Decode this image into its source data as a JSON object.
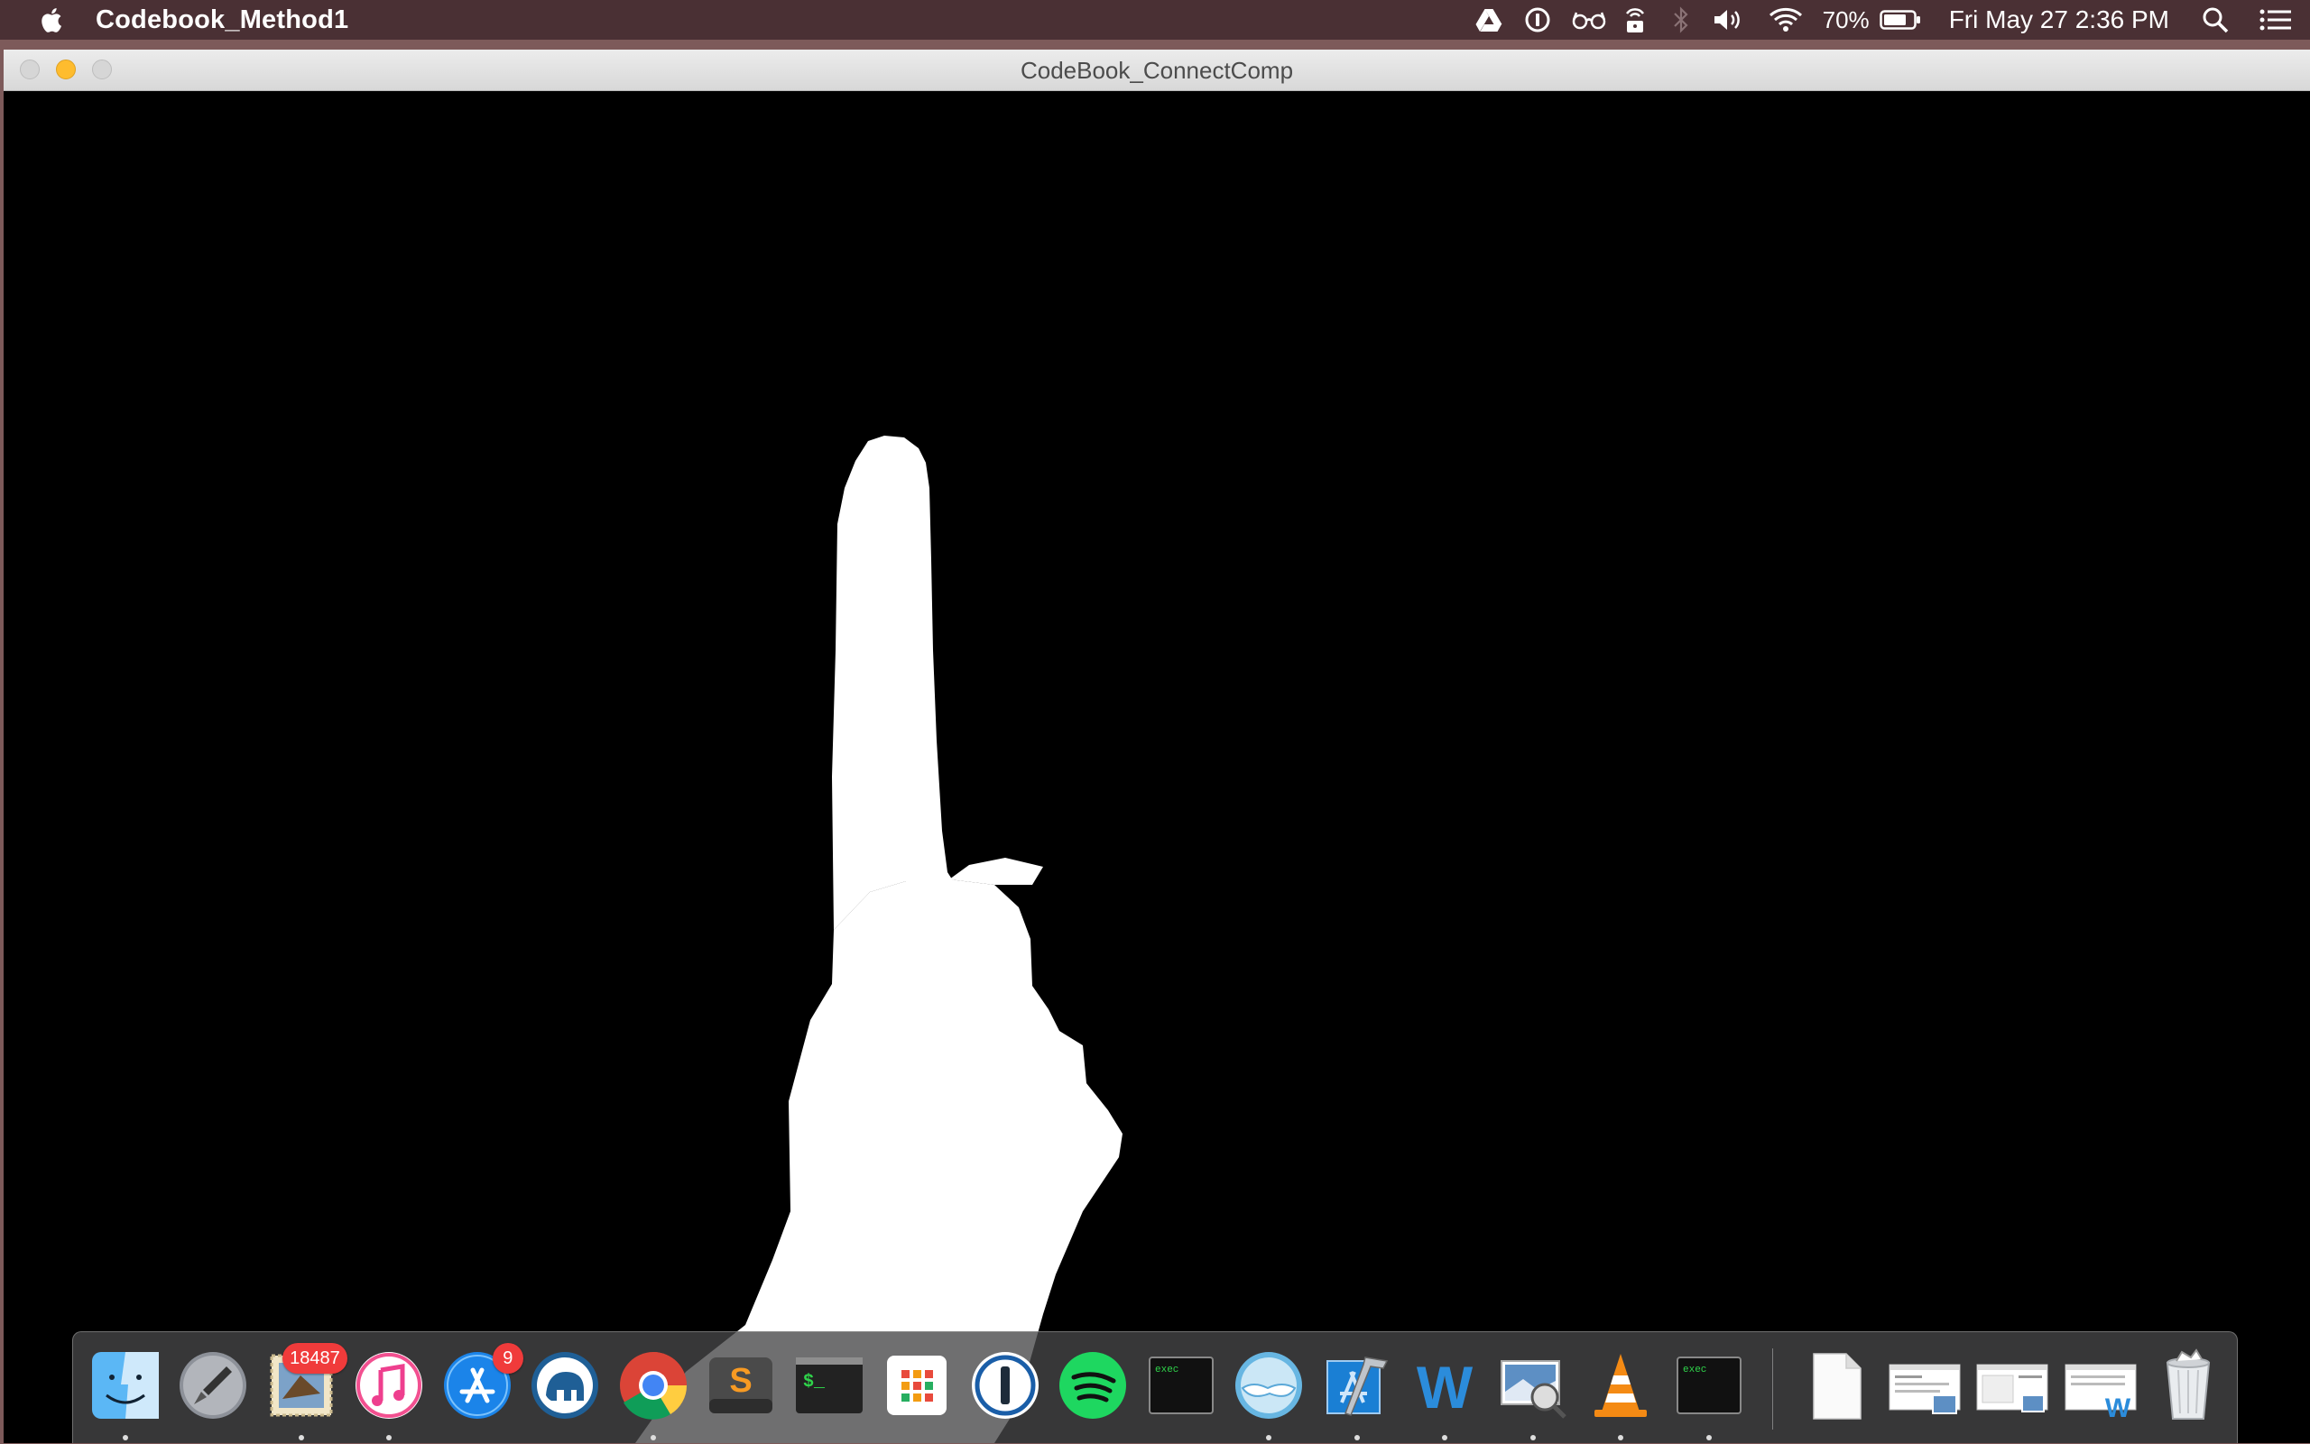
{
  "menubar": {
    "app_name": "Codebook_Method1",
    "battery_percent": "70%",
    "datetime": "Fri May 27  2:36 PM",
    "icons": [
      "apple-logo-icon",
      "google-drive-icon",
      "1password-mini-icon",
      "glasses-icon",
      "lock-broadcast-icon",
      "bluetooth-icon",
      "volume-icon",
      "wifi-icon",
      "battery-icon",
      "spotlight-search-icon",
      "notification-center-icon"
    ]
  },
  "window": {
    "title": "CodeBook_ConnectComp"
  },
  "dock": {
    "items": [
      {
        "name": "finder",
        "running": true
      },
      {
        "name": "launchpad",
        "running": false
      },
      {
        "name": "mail",
        "running": true,
        "badge": "18487"
      },
      {
        "name": "itunes",
        "running": true
      },
      {
        "name": "app-store",
        "running": false,
        "badge": "9"
      },
      {
        "name": "macdown",
        "running": false
      },
      {
        "name": "chrome",
        "running": true
      },
      {
        "name": "sublime-text",
        "running": false
      },
      {
        "name": "terminal",
        "running": false
      },
      {
        "name": "tweetdeck-grid",
        "running": false
      },
      {
        "name": "1password",
        "running": false
      },
      {
        "name": "spotify",
        "running": false
      },
      {
        "name": "exec-terminal",
        "running": false,
        "label": "exec"
      },
      {
        "name": "mustache-app",
        "running": true
      },
      {
        "name": "xcode",
        "running": true
      },
      {
        "name": "word",
        "running": true
      },
      {
        "name": "preview",
        "running": true
      },
      {
        "name": "vlc",
        "running": true
      },
      {
        "name": "exec-terminal-2",
        "running": true,
        "label": "exec"
      },
      {
        "name": "document-file",
        "running": false
      },
      {
        "name": "recent-window-1",
        "running": false
      },
      {
        "name": "recent-window-2",
        "running": false
      },
      {
        "name": "recent-window-3",
        "running": false
      },
      {
        "name": "trash",
        "running": false
      }
    ]
  },
  "colors": {
    "menubar_bg": "#4a3034",
    "canvas_bg": "#000000",
    "mask_fg": "#ffffff",
    "badge_red": "#f03b3b",
    "minimize_yellow": "#febc2e"
  }
}
